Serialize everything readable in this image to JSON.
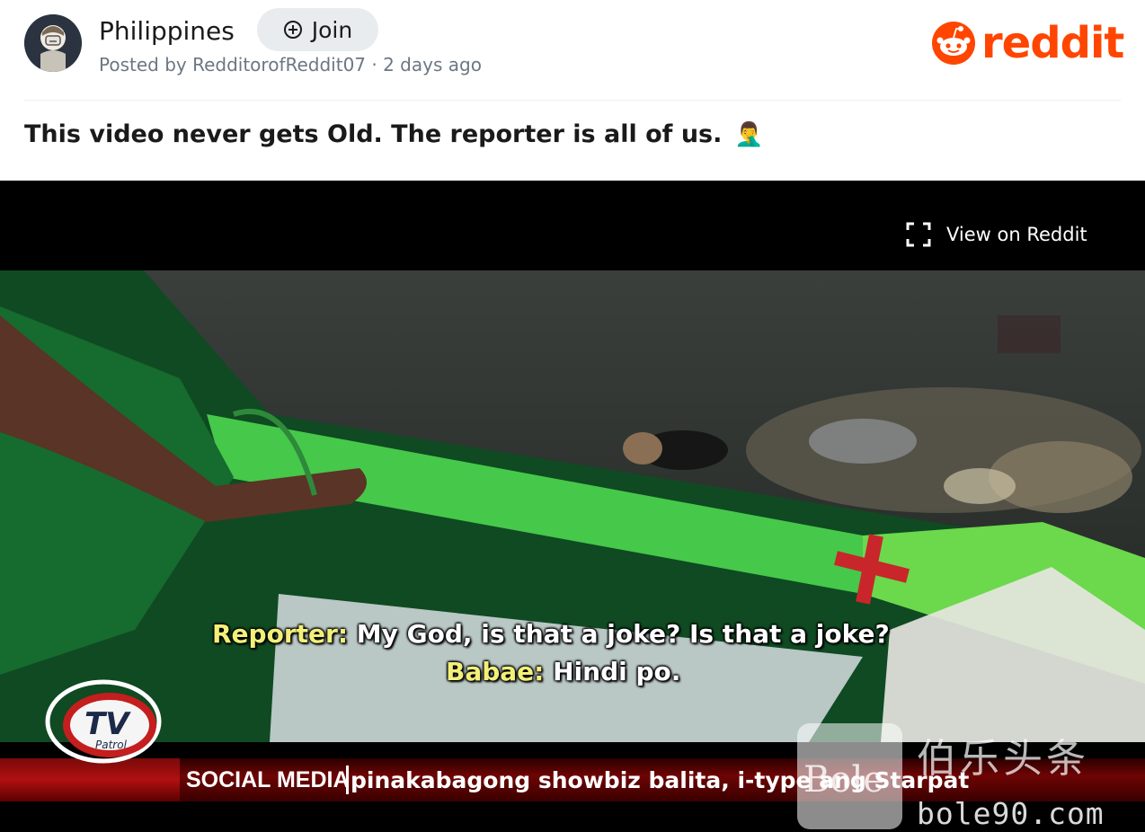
{
  "header": {
    "community_name": "Philippines",
    "join_label": "Join",
    "posted_by": "Posted by RedditorofReddit07 · 2 days ago",
    "brand": "reddit",
    "brand_color": "#ff4500"
  },
  "post": {
    "title": "This video never gets Old. The reporter is all of us.",
    "title_emoji": "🤦‍♂️"
  },
  "video": {
    "view_on_reddit_label": "View on Reddit",
    "subtitle_line1_speaker": "Reporter:",
    "subtitle_line1_text": "My God, is that a joke? Is that a joke?",
    "subtitle_line2_speaker": "Babae:",
    "subtitle_line2_text": "Hindi po.",
    "ticker_label": "SOCIAL MEDIA",
    "ticker_text": "pinakabagong showbiz balita, i-type ang Starpat",
    "tv_logo_text": "TV",
    "tv_logo_sub": "Patrol"
  },
  "watermark": {
    "box_text": "Bole",
    "chinese_text": "伯乐头条",
    "domain": "bole90.com"
  },
  "icons": {
    "join": "plus-circle-icon",
    "expand": "expand-icon",
    "emoji": "facepalm-emoji"
  }
}
